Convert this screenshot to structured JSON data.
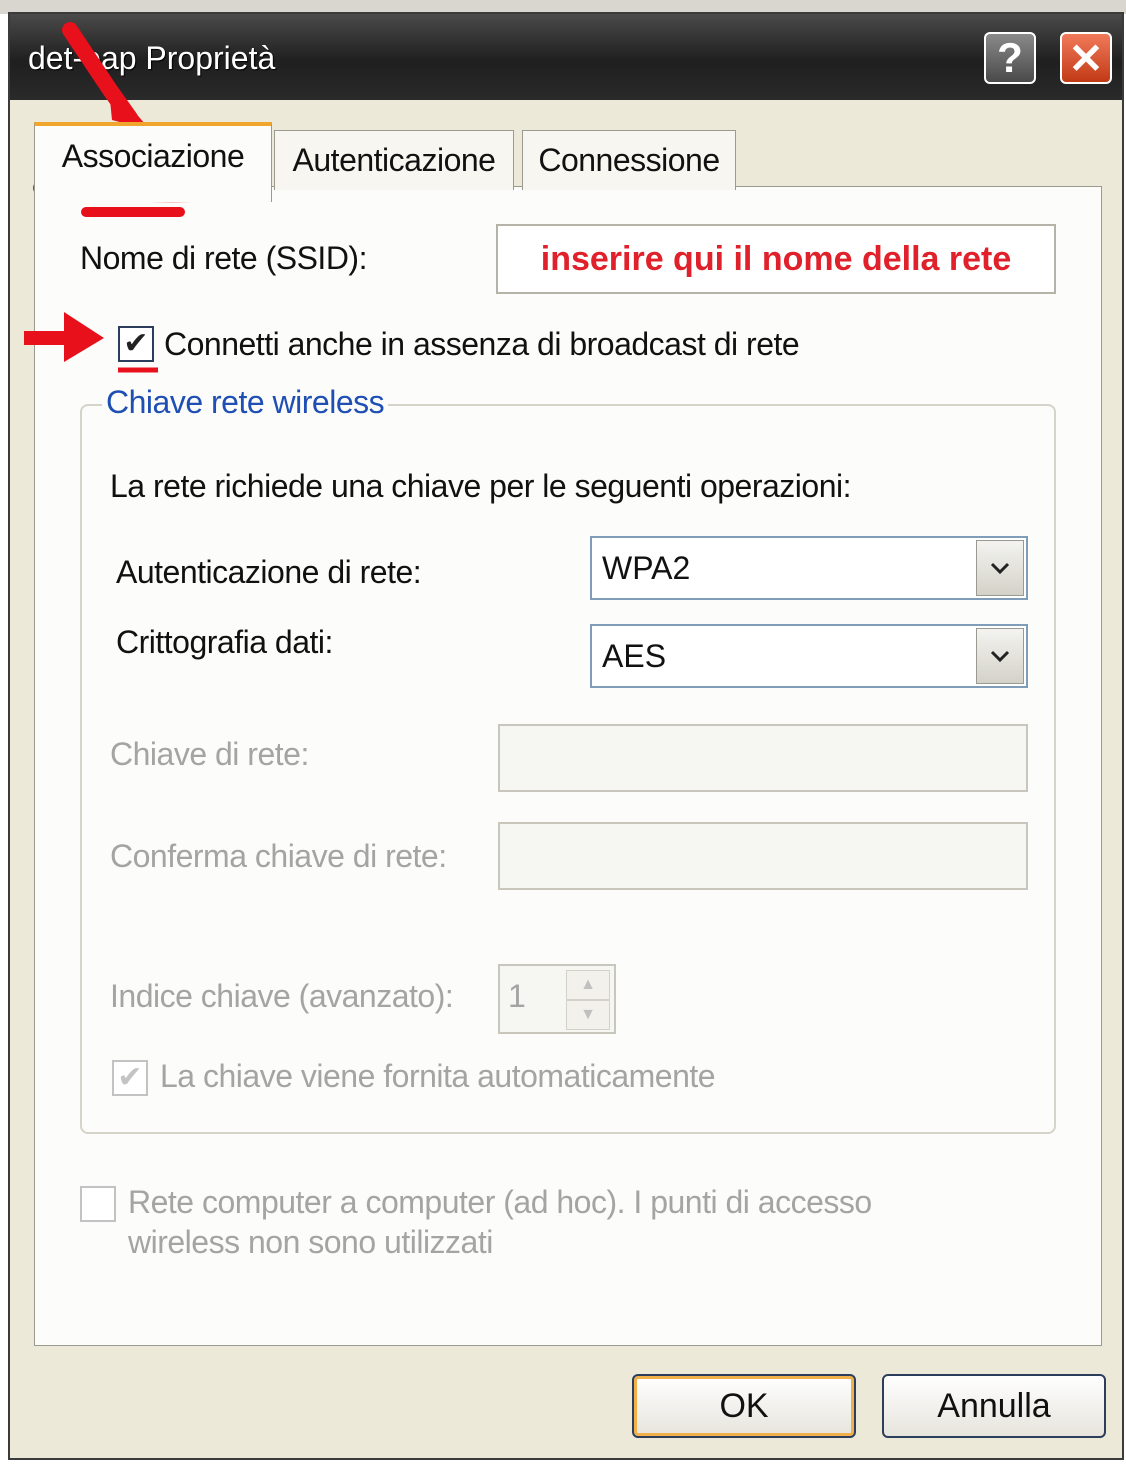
{
  "window": {
    "title": "det-eap Proprietà",
    "help_symbol": "?",
    "close_symbol": "✕"
  },
  "tabs": [
    {
      "label": "Associazione",
      "selected": true
    },
    {
      "label": "Autenticazione",
      "selected": false
    },
    {
      "label": "Connessione",
      "selected": false
    }
  ],
  "association": {
    "ssid_label": "Nome di rete (SSID):",
    "ssid_value": "inserire qui il nome della rete",
    "broadcast_checkbox_label": "Connetti anche in assenza di broadcast di rete",
    "broadcast_checked": true
  },
  "wireless_key": {
    "group_title": "Chiave rete wireless",
    "intro": "La rete richiede una chiave per le seguenti operazioni:",
    "auth_label": "Autenticazione di rete:",
    "auth_value": "WPA2",
    "encryption_label": "Crittografia dati:",
    "encryption_value": "AES",
    "key_label": "Chiave di rete:",
    "confirm_label": "Conferma chiave di rete:",
    "index_label": "Indice chiave (avanzato):",
    "index_value": "1",
    "auto_key_label": "La chiave viene fornita automaticamente",
    "auto_key_checked": true
  },
  "adhoc": {
    "label_line1": "Rete computer a computer (ad hoc). I punti di accesso",
    "label_line2": "wireless non sono utilizzati",
    "checked": false
  },
  "buttons": {
    "ok": "OK",
    "cancel": "Annulla"
  },
  "icons": {
    "check": "✔",
    "dropdown": "chevron-down-icon",
    "spin_up": "▲",
    "spin_down": "▼"
  },
  "colors": {
    "annotation_red": "#e8101a",
    "ssid_hint_red": "#e0202a",
    "group_title_blue": "#1f4fb4",
    "selected_tab_accent": "#f0a52d"
  }
}
